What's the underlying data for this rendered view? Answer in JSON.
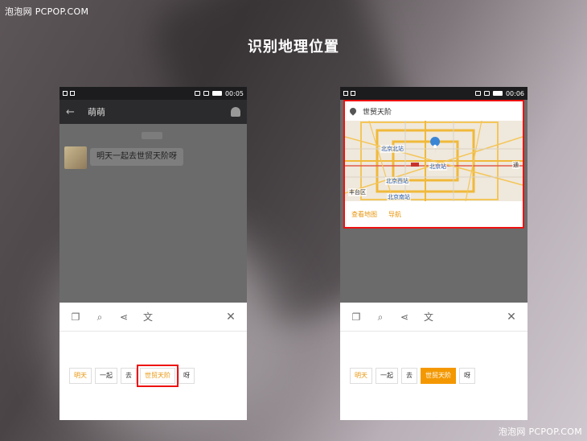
{
  "watermark": {
    "top": "泡泡网 PCPOP.COM",
    "bottom": "泡泡网 PCPOP.COM"
  },
  "headline": "识别地理位置",
  "colors": {
    "accent_orange": "#f39800",
    "highlight_red": "#ee1111"
  },
  "phone_left": {
    "status_time": "00:05",
    "chat_title": "萌萌",
    "message": "明天一起去世贸天阶呀",
    "toolbar_icons": [
      "copy-icon",
      "search-icon",
      "share-icon",
      "translate-icon",
      "close-icon"
    ],
    "chips": [
      "明天",
      "一起",
      "去",
      "世贸天阶",
      "呀"
    ],
    "selected_chip": "世贸天阶"
  },
  "phone_right": {
    "status_time": "00:06",
    "location_title": "世贸天阶",
    "map_labels": [
      "北京北站",
      "北京站",
      "北京西站",
      "北京南站",
      "丰台区",
      "通"
    ],
    "map_links": {
      "view_map": "查看地图",
      "navigate": "导航"
    },
    "toolbar_icons": [
      "copy-icon",
      "search-icon",
      "share-icon",
      "translate-icon",
      "close-icon"
    ],
    "chips": [
      "明天",
      "一起",
      "去",
      "世贸天阶",
      "呀"
    ],
    "selected_chip": "世贸天阶"
  }
}
